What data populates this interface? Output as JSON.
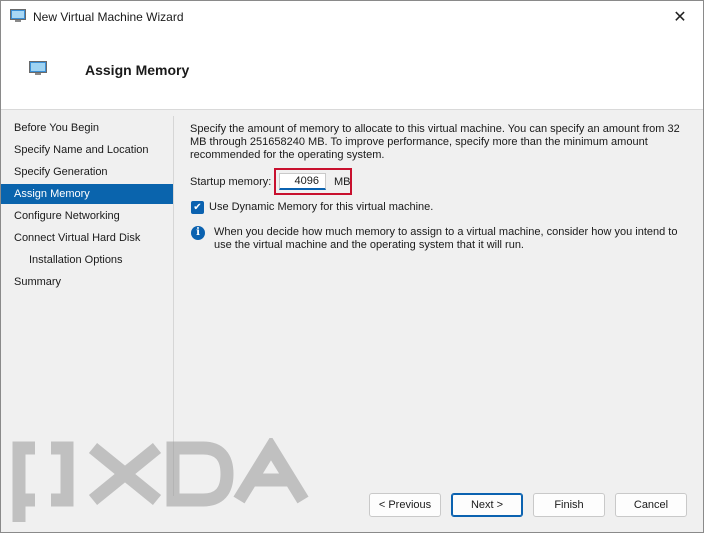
{
  "window": {
    "title": "New Virtual Machine Wizard",
    "close_glyph": "✕"
  },
  "header": {
    "title": "Assign Memory",
    "icon": "monitor-icon"
  },
  "sidebar": {
    "items": [
      {
        "label": "Before You Begin"
      },
      {
        "label": "Specify Name and Location"
      },
      {
        "label": "Specify Generation"
      },
      {
        "label": "Assign Memory",
        "active": true
      },
      {
        "label": "Configure Networking"
      },
      {
        "label": "Connect Virtual Hard Disk"
      },
      {
        "label": "Installation Options",
        "indent": true
      },
      {
        "label": "Summary"
      }
    ]
  },
  "main": {
    "description": "Specify the amount of memory to allocate to this virtual machine. You can specify an amount from 32 MB through 251658240 MB. To improve performance, specify more than the minimum amount recommended for the operating system.",
    "startup_label": "Startup memory:",
    "startup_value": "4096",
    "startup_unit": "MB",
    "dynamic_label": "Use Dynamic Memory for this virtual machine.",
    "dynamic_checked": true,
    "info_text": "When you decide how much memory to assign to a virtual machine, consider how you intend to use the virtual machine and the operating system that it will run."
  },
  "buttons": {
    "previous": "< Previous",
    "next": "Next >",
    "finish": "Finish",
    "cancel": "Cancel"
  },
  "colors": {
    "accent": "#0a64ad",
    "highlight": "#c8102e"
  },
  "watermark": {
    "text": "XDA"
  }
}
